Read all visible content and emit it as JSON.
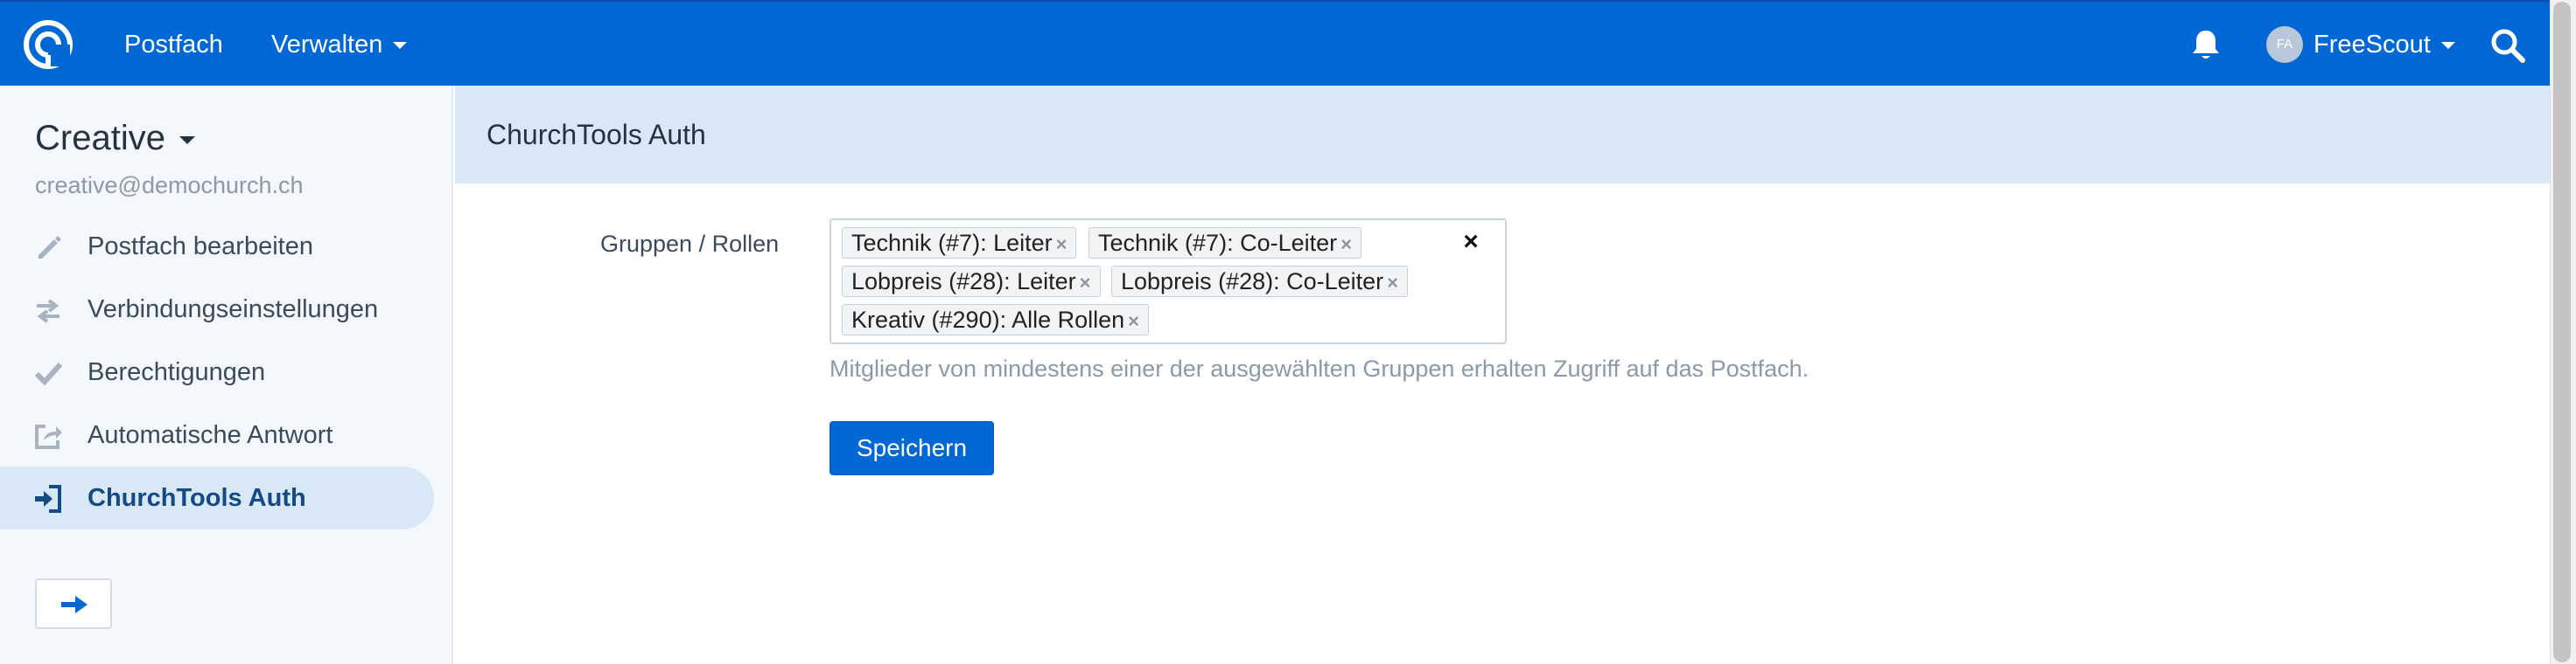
{
  "topbar": {
    "logo_icon": "freescout-logo-icon",
    "nav": [
      {
        "label": "Postfach"
      },
      {
        "label": "Verwalten"
      }
    ],
    "bell_icon": "bell-icon",
    "user": {
      "initials": "FA",
      "name": "FreeScout"
    },
    "search_icon": "search-icon",
    "color": "#0068d4"
  },
  "sidebar": {
    "mailbox_name": "Creative",
    "mailbox_email": "creative@demochurch.ch",
    "items": [
      {
        "label": "Postfach bearbeiten",
        "icon": "pencil-icon"
      },
      {
        "label": "Verbindungseinstellungen",
        "icon": "transfer-arrows-icon"
      },
      {
        "label": "Berechtigungen",
        "icon": "checkmark-icon"
      },
      {
        "label": "Automatische Antwort",
        "icon": "share-icon"
      },
      {
        "label": "ChurchTools Auth",
        "icon": "login-icon",
        "active": true
      }
    ],
    "collapse_icon": "arrow-right-icon"
  },
  "main": {
    "title": "ChurchTools Auth",
    "field_label": "Gruppen / Rollen",
    "tags": [
      "Technik (#7): Leiter",
      "Technik (#7): Co-Leiter",
      "Lobpreis (#28): Leiter",
      "Lobpreis (#28): Co-Leiter",
      "Kreativ (#290): Alle Rollen"
    ],
    "clear_symbol": "×",
    "remove_symbol": "×",
    "help_text": "Mitglieder von mindestens einer der ausgewählten Gruppen erhalten Zugriff auf das Postfach.",
    "save_label": "Speichern"
  }
}
